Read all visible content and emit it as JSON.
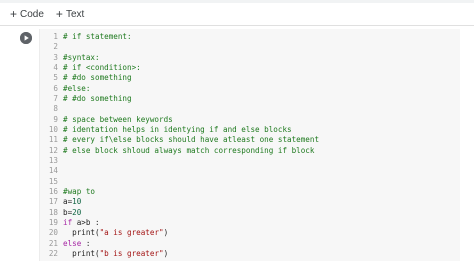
{
  "toolbar": {
    "add_code_label": "Code",
    "add_text_label": "Text",
    "plus_glyph": "+"
  },
  "cell": {
    "run_button_icon": "play-circle-icon",
    "lines": [
      {
        "n": "1",
        "text": "# if statement:",
        "kind": "comment"
      },
      {
        "n": "2",
        "text": "",
        "kind": "plain"
      },
      {
        "n": "3",
        "text": "#syntax:",
        "kind": "comment"
      },
      {
        "n": "4",
        "text": "# if <condition>:",
        "kind": "comment"
      },
      {
        "n": "5",
        "text": "# #do something",
        "kind": "comment"
      },
      {
        "n": "6",
        "text": "#else:",
        "kind": "comment"
      },
      {
        "n": "7",
        "text": "# #do something",
        "kind": "comment"
      },
      {
        "n": "8",
        "text": "",
        "kind": "plain"
      },
      {
        "n": "9",
        "text": "# space between keywords",
        "kind": "comment"
      },
      {
        "n": "10",
        "text": "# identation helps in identying if and else blocks",
        "kind": "comment"
      },
      {
        "n": "11",
        "text": "# every if\\else blocks should have atleast one statement",
        "kind": "comment"
      },
      {
        "n": "12",
        "text": "# else block shloud always match corresponding if block",
        "kind": "comment"
      },
      {
        "n": "13",
        "text": "",
        "kind": "plain"
      },
      {
        "n": "14",
        "text": "",
        "kind": "plain"
      },
      {
        "n": "15",
        "text": "",
        "kind": "plain"
      },
      {
        "n": "16",
        "text": "#wap to",
        "kind": "comment"
      },
      {
        "n": "17",
        "text": "a=10",
        "kind": "code"
      },
      {
        "n": "18",
        "text": "b=20",
        "kind": "code"
      },
      {
        "n": "19",
        "text": "if a>b :",
        "kind": "code"
      },
      {
        "n": "20",
        "text": "  print(\"a is greater\")",
        "kind": "code"
      },
      {
        "n": "21",
        "text": "else :",
        "kind": "code"
      },
      {
        "n": "22",
        "text": "  print(\"b is greater\")",
        "kind": "code"
      }
    ]
  }
}
